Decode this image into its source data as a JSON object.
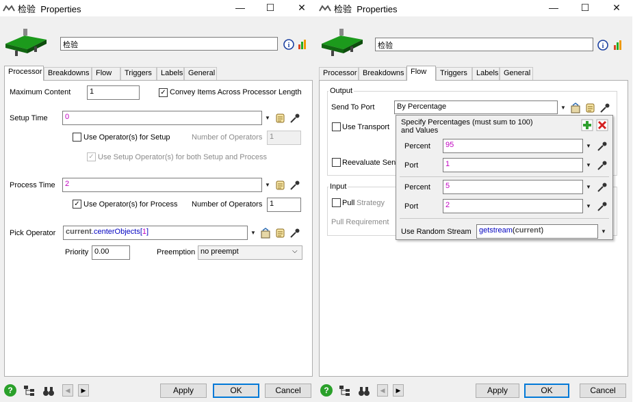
{
  "window": {
    "title": "检验  Properties",
    "object_name": "检验",
    "minimize_symbol": "—",
    "maximize_symbol": "☐",
    "close_symbol": "✕"
  },
  "tabs": [
    "Processor",
    "Breakdowns",
    "Flow",
    "Triggers",
    "Labels",
    "General"
  ],
  "processor": {
    "max_content_label": "Maximum Content",
    "max_content_value": "1",
    "convey_label": "Convey Items Across Processor Length",
    "convey_checked": true,
    "setup_time_label": "Setup Time",
    "setup_time_value": "0",
    "use_operator_setup_label": "Use Operator(s) for Setup",
    "use_operator_setup_checked": false,
    "setup_num_operators_label": "Number of Operators",
    "setup_num_operators_value": "1",
    "use_setup_both_label": "Use Setup Operator(s) for both Setup and Process",
    "use_setup_both_checked": true,
    "process_time_label": "Process Time",
    "process_time_value": "2",
    "use_operator_process_label": "Use Operator(s) for Process",
    "use_operator_process_checked": true,
    "process_num_operators_label": "Number of Operators",
    "process_num_operators_value": "1",
    "pick_operator_label": "Pick Operator",
    "pick_operator_kw": "current",
    "pick_operator_fn": ".centerObjects[",
    "pick_operator_idx": "1",
    "pick_operator_end": "]",
    "priority_label": "Priority",
    "priority_value": "0.00",
    "preemption_label": "Preemption",
    "preemption_value": "no preempt"
  },
  "flow": {
    "output_group": "Output",
    "send_to_port_label": "Send To Port",
    "send_to_port_value": "By Percentage",
    "use_transport_label": "Use Transport",
    "reevaluate_label": "Reevaluate Sen",
    "input_group": "Input",
    "pull_label": "Pull",
    "strategy_label": "Strategy",
    "pull_requirement_label": "Pull Requirement"
  },
  "popup": {
    "heading_line1": "Specify Percentages (must sum to 100)",
    "heading_line2": "and Values",
    "rows": [
      {
        "percent_label": "Percent",
        "percent_value": "95",
        "port_label": "Port",
        "port_value": "1"
      },
      {
        "percent_label": "Percent",
        "percent_value": "5",
        "port_label": "Port",
        "port_value": "2"
      }
    ],
    "random_stream_label": "Use Random Stream",
    "random_stream_fn": "getstream",
    "random_stream_open": "(",
    "random_stream_arg": "current",
    "random_stream_close": ")"
  },
  "footer": {
    "apply_label": "Apply",
    "ok_label": "OK",
    "cancel_label": "Cancel",
    "help_symbol": "?",
    "prev_symbol": "◀",
    "next_symbol": "▶"
  },
  "colors": {
    "accent": "#0078d7",
    "expression_value": "#c000c0",
    "keyword": "#0000c0",
    "add_icon": "#2ea02e",
    "remove_icon": "#d42020"
  }
}
